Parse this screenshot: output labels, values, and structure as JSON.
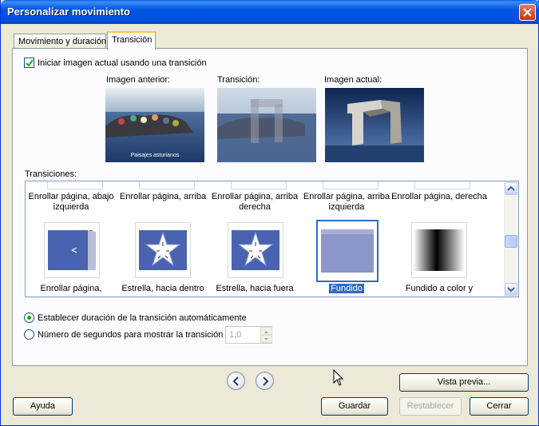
{
  "window": {
    "title": "Personalizar movimiento"
  },
  "tabs": [
    {
      "label": "Movimiento y duración",
      "active": false
    },
    {
      "label": "Transición",
      "active": true
    }
  ],
  "transition_checkbox": {
    "label": "Iniciar imagen actual usando una transición",
    "checked": true
  },
  "previews": {
    "previous": {
      "label": "Imagen anterior:",
      "caption": "Paisajes asturianos"
    },
    "transition": {
      "label": "Transición:"
    },
    "current": {
      "label": "Imagen actual:"
    }
  },
  "transitions": {
    "label": "Transiciones:",
    "row1": [
      {
        "label": "Enrollar página, abajo izquierda"
      },
      {
        "label": "Enrollar página, arriba"
      },
      {
        "label": "Enrollar página, arriba derecha"
      },
      {
        "label": "Enrollar página, arriba izquierda"
      },
      {
        "label": "Enrollar página, derecha"
      }
    ],
    "row2": [
      {
        "label": "Enrollar página,",
        "icon": "page-curl-left-icon"
      },
      {
        "label": "Estrella, hacia dentro",
        "icon": "star-inward-icon"
      },
      {
        "label": "Estrella, hacia fuera",
        "icon": "star-outward-icon"
      },
      {
        "label": "Fundido",
        "icon": "fade-icon",
        "selected": true
      },
      {
        "label": "Fundido a color y",
        "icon": "fade-to-color-icon"
      }
    ]
  },
  "duration": {
    "auto_label": "Establecer duración de la transición automáticamente",
    "auto_selected": true,
    "seconds_label": "Número de segundos para mostrar la transición",
    "seconds_value": "1,0"
  },
  "buttons": {
    "preview": "Vista previa...",
    "help": "Ayuda",
    "save": "Guardar",
    "reset": "Restablecer",
    "close": "Cerrar"
  },
  "colors": {
    "title_bar": "#0054e3",
    "accent": "#316ac5",
    "tile_blue": "#4a63b0",
    "face": "#ece9d8"
  }
}
